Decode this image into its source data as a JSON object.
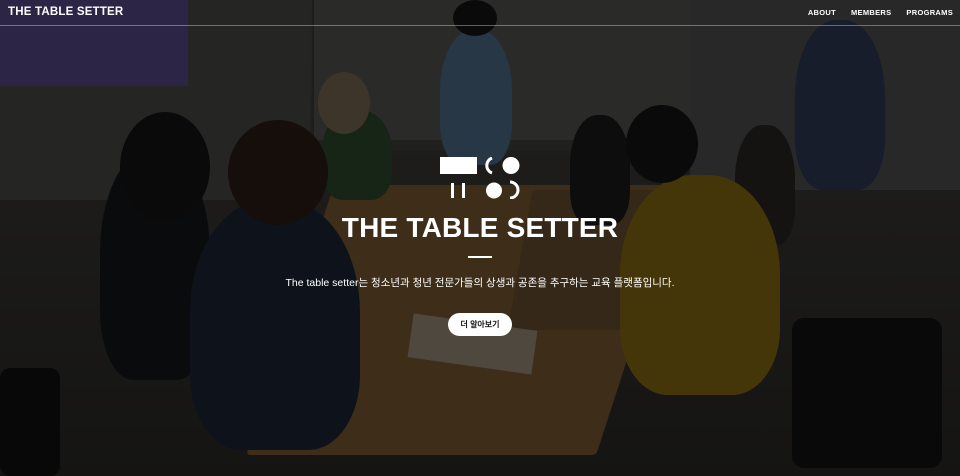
{
  "nav": {
    "brand": "THE TABLE SETTER",
    "items": [
      {
        "label": "ABOUT"
      },
      {
        "label": "MEMBERS"
      },
      {
        "label": "PROGRAMS"
      }
    ]
  },
  "hero": {
    "title": "THE TABLE SETTER",
    "tagline": "The table setter는 청소년과 청년 전문가들의 상생과 공존을 추구하는 교육 플랫폼입니다.",
    "cta_label": "더 알아보기"
  },
  "colors": {
    "text": "#ffffff",
    "cta_bg": "#ffffff",
    "cta_text": "#111111"
  }
}
